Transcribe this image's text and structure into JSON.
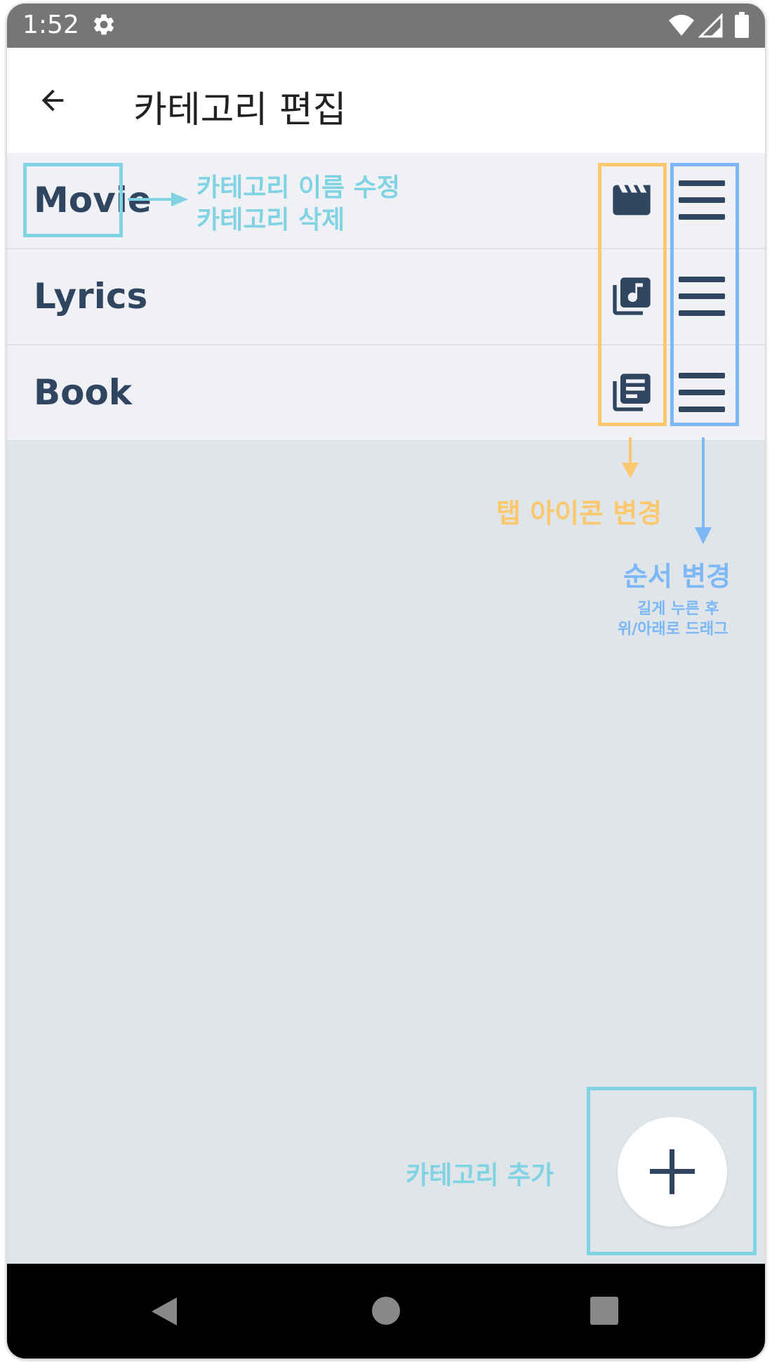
{
  "status_bar": {
    "time": "1:52",
    "icons": [
      "settings-gear-icon",
      "wifi-icon",
      "signal-icon",
      "battery-icon"
    ]
  },
  "app_bar": {
    "title": "카테고리 편집",
    "back_icon": "arrow-back-icon"
  },
  "categories": [
    {
      "label": "Movie",
      "tab_icon": "movie-clapperboard-icon"
    },
    {
      "label": "Lyrics",
      "tab_icon": "music-library-icon"
    },
    {
      "label": "Book",
      "tab_icon": "library-books-icon"
    }
  ],
  "annotations": {
    "edit_line1": "카테고리 이름 수정",
    "edit_line2": "카테고리 삭제",
    "tab_icon_change": "탭 아이콘 변경",
    "order_change": "순서 변경",
    "order_hint_line1": "길게 누른 후",
    "order_hint_line2": "위/아래로 드래그",
    "add_category": "카테고리 추가"
  },
  "fab_icon": "add-plus-icon",
  "colors": {
    "teal_annotation": "#7fd3e3",
    "orange_annotation": "#fcc86d",
    "blue_annotation": "#7cb7f6",
    "icon_dark": "#2f4560",
    "status_bar": "#767676",
    "content_background": "#dfe5e9",
    "row_background": "#eff1f5"
  },
  "nav_bar": {
    "icons": [
      "nav-back-icon",
      "nav-home-icon",
      "nav-recents-icon"
    ]
  }
}
